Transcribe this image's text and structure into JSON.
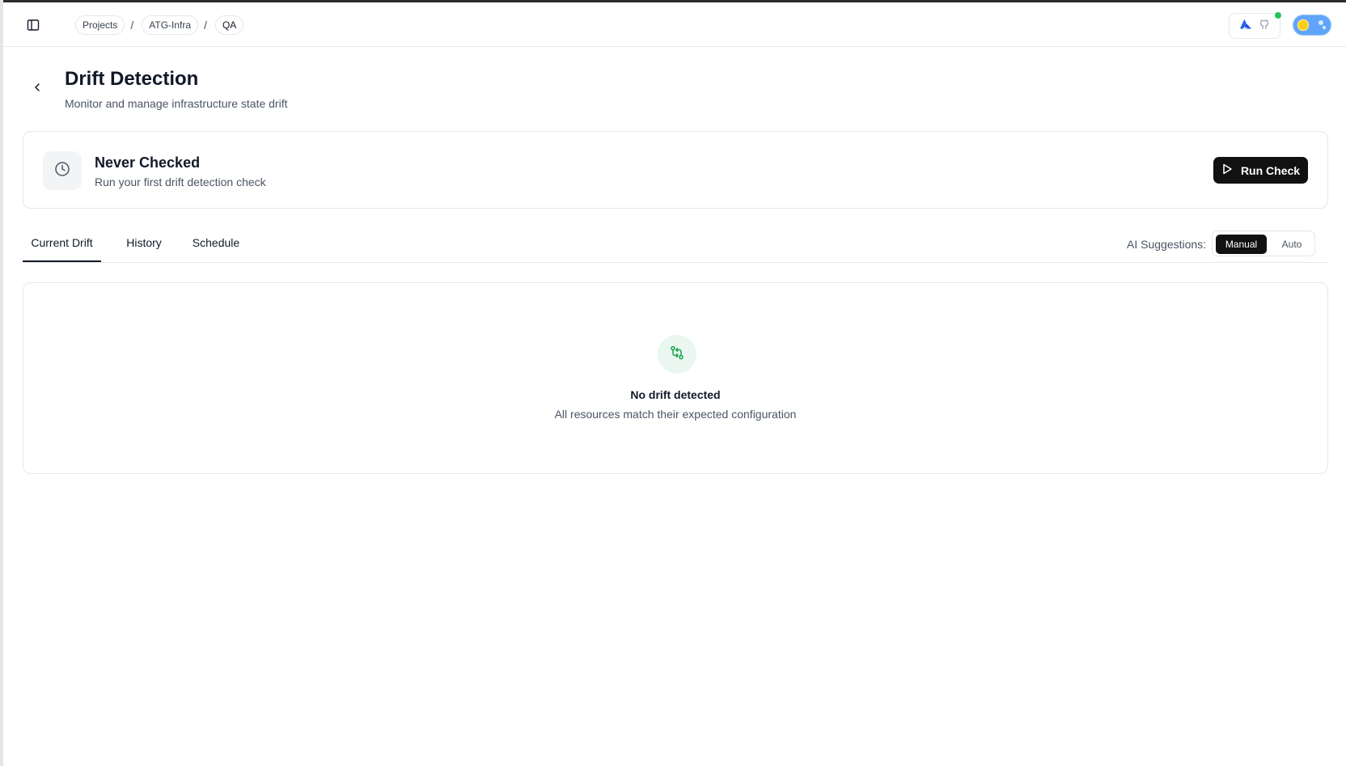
{
  "breadcrumb": {
    "items": [
      "Projects",
      "ATG-Infra",
      "QA"
    ],
    "separator": "/"
  },
  "icons": {
    "sidebar_toggle": "panel-left-icon",
    "integration_1": "azure-icon",
    "integration_2": "github-icon",
    "theme": "sun-icon",
    "back": "chevron-left-icon",
    "status": "clock-icon",
    "run": "play-icon",
    "empty": "git-compare-icon"
  },
  "colors": {
    "primary": "#111111",
    "status_online": "#22c55e",
    "success_tint": "#e9f7f0",
    "success_icon": "#16a34a",
    "theme_toggle": "#60a5fa",
    "sun": "#facc15"
  },
  "page": {
    "title": "Drift Detection",
    "subtitle": "Monitor and manage infrastructure state drift"
  },
  "status_card": {
    "title": "Never Checked",
    "description": "Run your first drift detection check",
    "action_label": "Run Check"
  },
  "tabs": [
    {
      "label": "Current Drift",
      "active": true
    },
    {
      "label": "History",
      "active": false
    },
    {
      "label": "Schedule",
      "active": false
    }
  ],
  "ai_suggestions": {
    "label": "AI Suggestions:",
    "options": [
      "Manual",
      "Auto"
    ],
    "selected": "Manual"
  },
  "empty_state": {
    "title": "No drift detected",
    "description": "All resources match their expected configuration"
  }
}
